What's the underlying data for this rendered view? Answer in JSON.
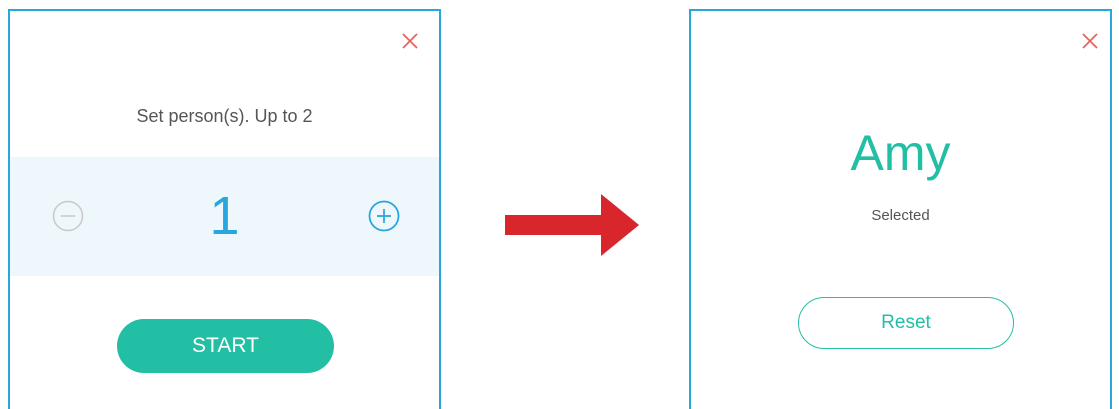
{
  "left_panel": {
    "prompt": "Set person(s). Up to 2",
    "count": "1",
    "start_label": "START",
    "icons": {
      "close": "close-icon",
      "decrement": "minus-circle-icon",
      "increment": "plus-circle-icon"
    }
  },
  "transition": {
    "icon": "right-arrow-icon",
    "color": "#d9262c"
  },
  "right_panel": {
    "name": "Amy",
    "status": "Selected",
    "reset_label": "Reset",
    "icons": {
      "close": "close-icon"
    }
  },
  "colors": {
    "panel_border": "#2aa6de",
    "accent_green": "#22bfa5",
    "accent_blue": "#2aa6de",
    "close_red": "#e8625e",
    "stepper_band": "#eef7fb",
    "disabled_gray": "#c8c8c8"
  }
}
